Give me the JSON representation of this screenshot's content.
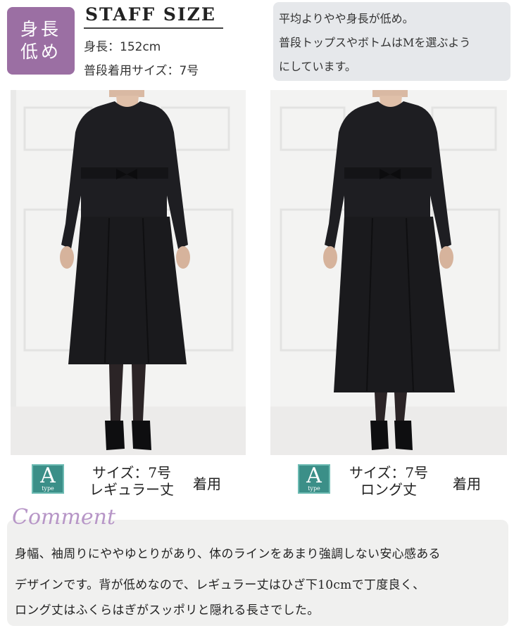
{
  "badge": {
    "line1": "身長",
    "line2": "低め"
  },
  "staff": {
    "title": "STAFF SIZE",
    "height": "身長：152cm",
    "usual_size": "普段着用サイズ：7号"
  },
  "note": [
    "平均よりやや身長が低め。",
    "普段トップスやボトムはMを選ぶよう",
    "にしています。"
  ],
  "photos": [
    {
      "type_letter": "A",
      "type_small": "type",
      "size_line1": "サイズ：7号",
      "size_line2": "レギュラー丈",
      "wearing": "着用"
    },
    {
      "type_letter": "A",
      "type_small": "type",
      "size_line1": "サイズ：7号",
      "size_line2": "ロング丈",
      "wearing": "着用"
    }
  ],
  "comment": {
    "heading": "Comment",
    "lines": [
      "身幅、袖周りにややゆとりがあり、体のラインをあまり強調しない安心感ある",
      "デザインです。背が低めなので、レギュラー丈はひざ下10cmで丁度良く、",
      "ロング丈はふくらはぎがスッポリと隠れる長さでした。"
    ]
  },
  "colors": {
    "badge": "#9b6fa3",
    "note_bg": "#e6e8eb",
    "type_badge": "#3b8f88",
    "comment_heading": "#b796c7",
    "comment_bg": "#f0f0ef"
  }
}
